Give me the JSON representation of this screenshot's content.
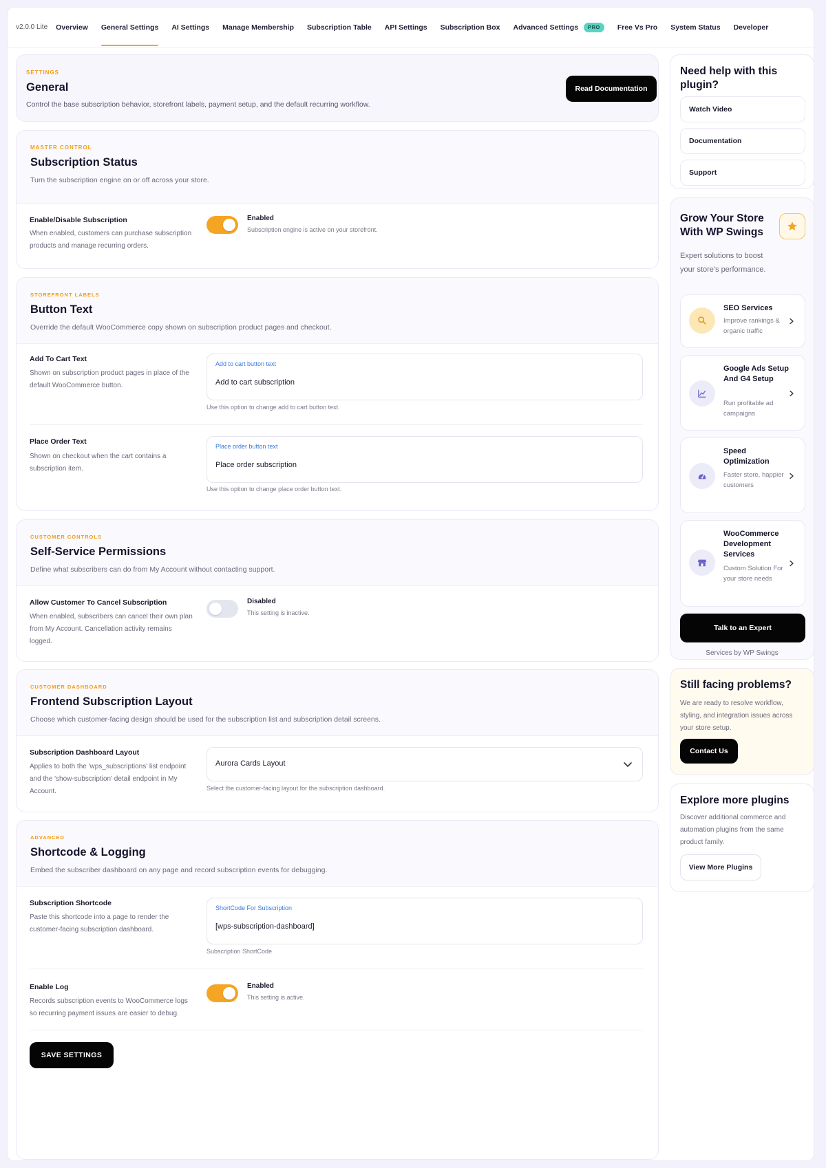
{
  "nav": {
    "version": "v2.0.0 Lite",
    "items": [
      {
        "label": "Overview"
      },
      {
        "label": "General Settings"
      },
      {
        "label": "AI Settings"
      },
      {
        "label": "Manage Membership"
      },
      {
        "label": "Subscription Table"
      },
      {
        "label": "API Settings"
      },
      {
        "label": "Subscription Box"
      },
      {
        "label": "Advanced Settings"
      },
      {
        "label": "Free Vs Pro"
      },
      {
        "label": "System Status"
      },
      {
        "label": "Developer"
      }
    ],
    "active": "General Settings",
    "pro_badge": "PRO"
  },
  "header": {
    "eyebrow": "SETTINGS",
    "title": "General",
    "description": "Control the base subscription behavior, storefront labels, payment setup, and the default recurring workflow.",
    "read_docs": "Read Documentation"
  },
  "status": {
    "eyebrow": "MASTER CONTROL",
    "title": "Subscription Status",
    "description": "Turn the subscription engine on or off across your store.",
    "row": {
      "label": "Enable/Disable Subscription",
      "help": "When enabled, customers can purchase subscription products and manage recurring orders.",
      "state": "Enabled",
      "state_sub": "Subscription engine is active on your storefront."
    }
  },
  "button_text": {
    "eyebrow": "STOREFRONT LABELS",
    "title": "Button Text",
    "description": "Override the default WooCommerce copy shown on subscription product pages and checkout.",
    "add_to_cart": {
      "label": "Add To Cart Text",
      "help": "Shown on subscription product pages in place of the default WooCommerce button.",
      "field_label": "Add to cart button text",
      "value": "Add to cart subscription",
      "note": "Use this option to change add to cart button text."
    },
    "place_order": {
      "label": "Place Order Text",
      "help": "Shown on checkout when the cart contains a subscription item.",
      "field_label": "Place order button text",
      "value": "Place order subscription",
      "note": "Use this option to change place order button text."
    }
  },
  "permissions": {
    "eyebrow": "CUSTOMER CONTROLS",
    "title": "Self-Service Permissions",
    "description": "Define what subscribers can do from My Account without contacting support.",
    "row": {
      "label": "Allow Customer To Cancel Subscription",
      "help": "When enabled, subscribers can cancel their own plan from My Account. Cancellation activity remains logged.",
      "state": "Disabled",
      "state_sub": "This setting is inactive."
    }
  },
  "layout": {
    "eyebrow": "CUSTOMER DASHBOARD",
    "title": "Frontend Subscription Layout",
    "description": "Choose which customer-facing design should be used for the subscription list and subscription detail screens.",
    "row": {
      "label": "Subscription Dashboard Layout",
      "help": "Applies to both the 'wps_subscriptions' list endpoint and the 'show-subscription' detail endpoint in My Account.",
      "selected": "Aurora Cards Layout",
      "note": "Select the customer-facing layout for the subscription dashboard."
    }
  },
  "advanced": {
    "eyebrow": "ADVANCED",
    "title": "Shortcode & Logging",
    "description": "Embed the subscriber dashboard on any page and record subscription events for debugging.",
    "shortcode": {
      "label": "Subscription Shortcode",
      "help": "Paste this shortcode into a page to render the customer-facing subscription dashboard.",
      "field_label": "ShortCode For Subscription",
      "value": "[wps-subscription-dashboard]",
      "note": "Subscription ShortCode"
    },
    "log": {
      "label": "Enable Log",
      "help": "Records subscription events to WooCommerce logs so recurring payment issues are easier to debug.",
      "state": "Enabled",
      "state_sub": "This setting is active."
    },
    "save": "SAVE SETTINGS"
  },
  "help": {
    "title": "Need help with this plugin?",
    "links": [
      "Watch Video",
      "Documentation",
      "Support"
    ]
  },
  "grow": {
    "title": "Grow Your Store With WP Swings",
    "subtitle": "Expert solutions to boost your store's performance.",
    "services": [
      {
        "title": "SEO Services",
        "desc": "Improve rankings & organic traffic",
        "icon": "search-icon"
      },
      {
        "title": "Google Ads Setup And G4 Setup",
        "desc": "Run profitable ad campaigns",
        "icon": "chart-icon"
      },
      {
        "title": "Speed Optimization",
        "desc": "Faster store, happier customers",
        "icon": "gauge-icon"
      },
      {
        "title": "WooCommerce Development Services",
        "desc": "Custom Solution For your store needs",
        "icon": "store-icon"
      }
    ],
    "cta": "Talk to an Expert",
    "footer": "Services by WP Swings"
  },
  "problems": {
    "title": "Still facing problems?",
    "text": "We are ready to resolve workflow, styling, and integration issues across your store setup.",
    "cta": "Contact Us"
  },
  "explore": {
    "title": "Explore more plugins",
    "text": "Discover additional commerce and automation plugins from the same product family.",
    "cta": "View More Plugins"
  },
  "colors": {
    "accent": "#f5a524",
    "link_blue": "#3a78d6",
    "pro_badge": "#5cd3c0"
  }
}
